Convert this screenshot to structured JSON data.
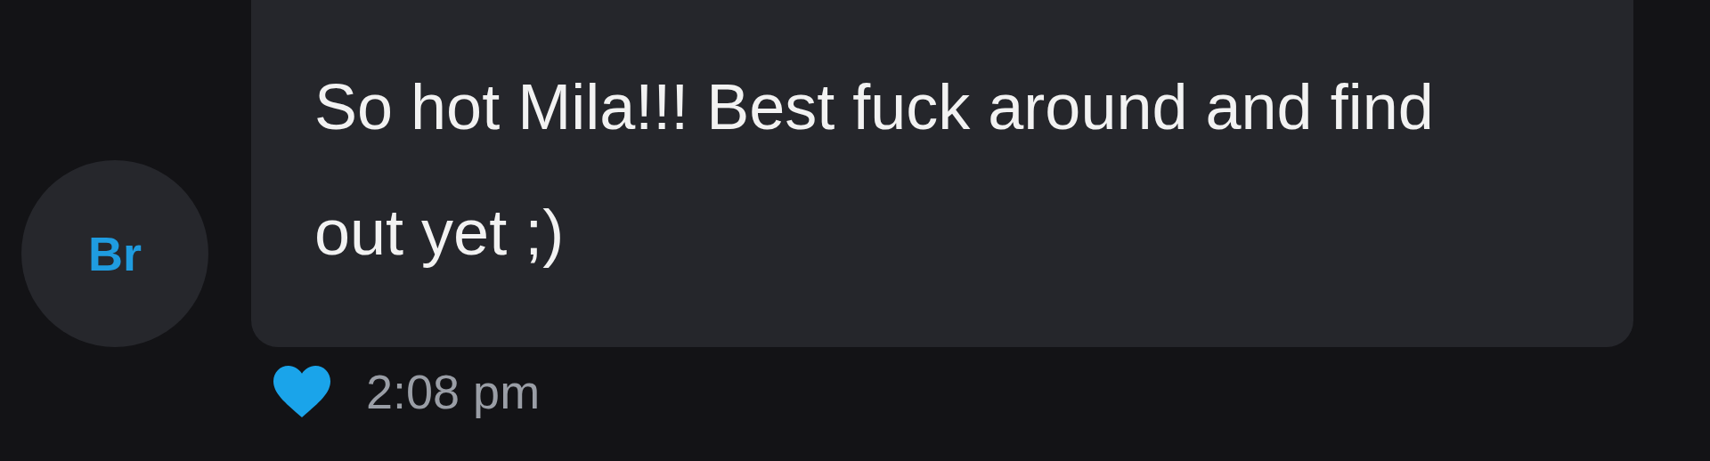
{
  "avatar": {
    "initials": "Br"
  },
  "message": {
    "text": "So hot Mila!!! Best fuck around and find out yet ;)",
    "liked": true,
    "time": "2:08 pm"
  }
}
